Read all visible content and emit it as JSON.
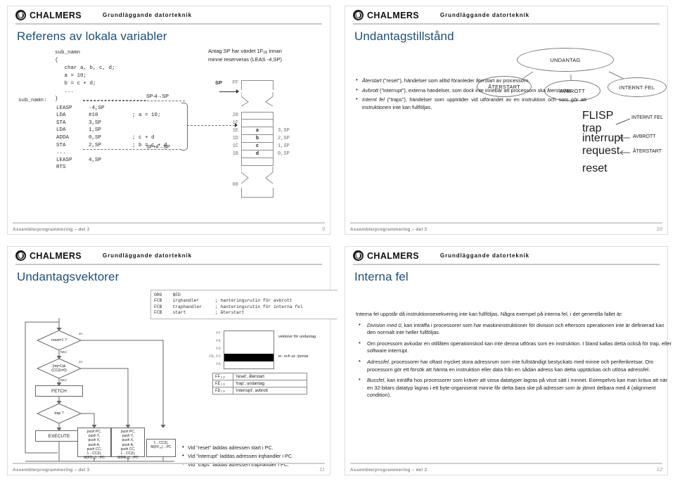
{
  "header": {
    "brand": "CHALMERS",
    "course": "Grundläggande datorteknik"
  },
  "footer": {
    "text": "Assemblerprogrammering – del 3"
  },
  "slides": [
    {
      "title": "Referens av lokala variabler",
      "page": "9",
      "c_source": "sub_namn\n{\n   char a, b, c, d;\n   a = 10;\n   b = c + d;\n   ...\n}",
      "asm_label": "sub_namn:",
      "asm": [
        {
          "op": "LEASP",
          "arg": "-4,SP",
          "cmt": ""
        },
        {
          "op": "LDA",
          "arg": "#10",
          "cmt": "; a = 10;"
        },
        {
          "op": "STA",
          "arg": "3,SP",
          "cmt": ""
        },
        {
          "op": "LDA",
          "arg": "1,SP",
          "cmt": ""
        },
        {
          "op": "ADDA",
          "arg": "0,SP",
          "cmt": "; c + d"
        },
        {
          "op": "STA",
          "arg": "2,SP",
          "cmt": "; b = c + d"
        },
        {
          "op": "...",
          "arg": "",
          "cmt": ""
        },
        {
          "op": "LEASP",
          "arg": "4,SP",
          "cmt": ""
        },
        {
          "op": "RTS",
          "arg": "",
          "cmt": ""
        }
      ],
      "effect_alloc": "SP-4→SP",
      "effect_free": "SP+4→SP",
      "note_line1": "Antag SP har värdet 1F",
      "note_sub": "16",
      "note_line1b": " innan",
      "note_line2": "minne reserveras (LEAS -4,SP)",
      "sp_label": "SP",
      "memory": {
        "top_addr": "FF",
        "bottom_addr": "00",
        "rows": [
          {
            "addr": "20",
            "val": "",
            "right": ""
          },
          {
            "addr": "1F",
            "val": "",
            "right": ""
          },
          {
            "addr": "1E",
            "val": "a",
            "right": "3,SP"
          },
          {
            "addr": "1D",
            "val": "b",
            "right": "2,SP"
          },
          {
            "addr": "1C",
            "val": "c",
            "right": "1,SP"
          },
          {
            "addr": "1B",
            "val": "d",
            "right": "0,SP"
          },
          {
            "addr": "",
            "val": "",
            "right": ""
          }
        ]
      }
    },
    {
      "title": "Undantagstillstånd",
      "page": "10",
      "tree": {
        "root": "UNDANTAG",
        "children": [
          "ÅTERSTART",
          "AVBROTT",
          "INTERNT FEL"
        ]
      },
      "bullets": [
        {
          "em": "Återstart",
          "rest": " (\"reset\"), händelser som alltid föranleder återstart av processorn."
        },
        {
          "em": "Avbrott",
          "rest": " (\"interrupt\"), externa händelser, som dock inte innebär att processorn ska återstartas."
        },
        {
          "em": "Internt fel",
          "rest": " (\"traps\"), händelser som uppträder vid utförandet av en instruktion och som gör att instruktionen inte kan fullföljas."
        }
      ],
      "flisp": {
        "title": "FLISP",
        "trap": "trap",
        "irq": "interrupt request",
        "reset": "reset",
        "lbl_trap": "INTERNT FEL",
        "lbl_irq": "AVBROTT",
        "lbl_reset": "ÅTERSTART"
      }
    },
    {
      "title": "Undantagsvektorer",
      "page": "11",
      "listing": "ORG    $FD\nFCB    irqhandler      ; hanteringsrutin för avbrott\nFCB    traphandler     ; hanteringsrutin för interna fel\nFCB    start           ; återstart",
      "flow": {
        "d1": "reset=1 ?",
        "d2": "(irq=1)&\n(CC(I)=0)",
        "d3": "trap ?",
        "fetch": "FETCH",
        "execute": "EXECUTE",
        "yes": "JA",
        "no": "NEJ",
        "push_reset": "push PC,\npush Y,\npush X,\npush A,\npush CC,\n1→CC(I),\nM(FF₁₆)→PC",
        "push_irq": "push PC,\npush Y,\npush X,\npush A,\npush CC,\n1→CC(I),\nM(FE₁₆)→PC",
        "push_trap": "push PC,\npush Y,\npush X,\npush A,\npush CC,\n1→CC(I),\nM(FD₁₆)→PC"
      },
      "vectors": {
        "addrs": [
          "FF",
          "FE",
          "FD",
          "FB,FC",
          "FA"
        ],
        "note_vectors": "vektorer för undantag",
        "note_ports": "in- och ut- /portar",
        "table": [
          {
            "addr": "FF₁₆",
            "desc": "'reset', återstart"
          },
          {
            "addr": "FE₁₆",
            "desc": "'trap', undantag"
          },
          {
            "addr": "FD₁₆",
            "desc": "'interrupt', avbrott"
          }
        ]
      },
      "bullets": [
        "Vid \"reset\" laddas adressen start i PC.",
        "Vid \"interrupt\" laddas adressen irqhandler i PC.",
        "Vid \"traps\" laddas adressen traphandler i PC."
      ],
      "bullet_code": [
        "start",
        "irqhandler",
        "traphandler"
      ]
    },
    {
      "title": "Interna fel",
      "page": "12",
      "intro": "Interna fel uppstår då instruktionsexekvering inte kan fullföljas. Några exempel på interna fel, i det generella fallet är:",
      "bullets": [
        {
          "em": "Division med 0",
          "rest": ", kan inträffa i processorer som har maskininstruktioner för division och eftersom operationen inte är definierad kan den normalt inte heller fullföljas."
        },
        {
          "em": "",
          "rest": "Om processorn avkodar en otillåten operationskod kan inte denna utföras som en instruktion. I bland kallas detta också för trap, eller software interrupt."
        },
        {
          "em": "Adressfel",
          "rest": ", processorer har oftast mycket stora adressrum som inte fullständigt bestyckats med minne och periferikretsar.  Om processorn gör ett försök att hämta en instruktion eller data från en sådan adress kan detta upptäckas och utlösa adressfel."
        },
        {
          "em": "Bussfel",
          "rest": ", kan inträffa hos processorer som kräver att vissa datatyper lagras på visst sätt i minnet. Exempelvis kan man kräva att när en 32-bitars datatyp lagras i ett byte-organiserat minne får detta bara ske på adresser som är jämnt delbara med 4 (alignment condition)."
        }
      ]
    }
  ],
  "colors": {
    "title": "#1f4e79",
    "rule": "#c8c8c8",
    "footer_text": "#8d8d8d"
  }
}
